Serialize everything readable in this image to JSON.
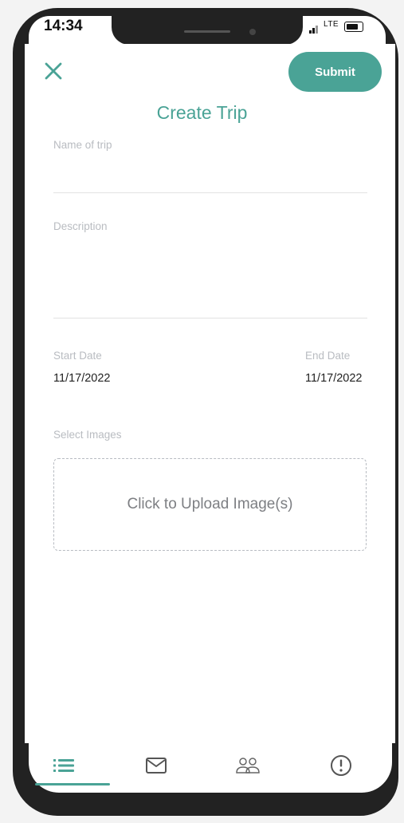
{
  "status": {
    "time": "14:34",
    "network": "LTE"
  },
  "header": {
    "submit_label": "Submit",
    "title": "Create Trip"
  },
  "form": {
    "name_label": "Name of trip",
    "description_label": "Description",
    "start_date_label": "Start Date",
    "start_date_value": "11/17/2022",
    "end_date_label": "End Date",
    "end_date_value": "11/17/2022",
    "images_label": "Select Images",
    "upload_text": "Click to Upload Image(s)"
  },
  "nav": {
    "tabs": [
      {
        "icon": "list-icon",
        "active": true
      },
      {
        "icon": "mail-icon",
        "active": false
      },
      {
        "icon": "people-icon",
        "active": false
      },
      {
        "icon": "alert-icon",
        "active": false
      }
    ]
  },
  "colors": {
    "accent": "#4aa396",
    "label": "#b9bcc1",
    "text": "#222222"
  }
}
